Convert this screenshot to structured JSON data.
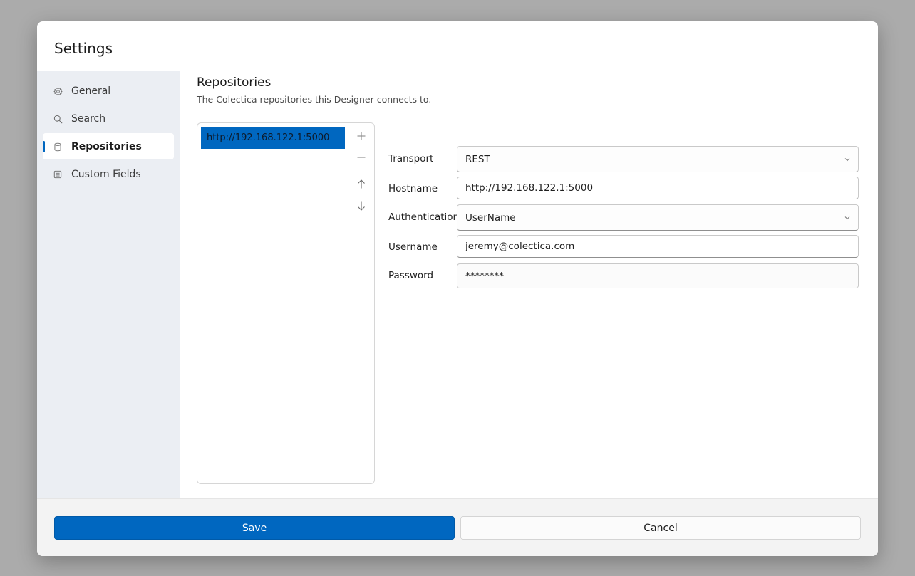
{
  "dialog": {
    "title": "Settings"
  },
  "sidebar": {
    "items": [
      {
        "label": "General",
        "icon": "gear-icon",
        "selected": false
      },
      {
        "label": "Search",
        "icon": "search-icon",
        "selected": false
      },
      {
        "label": "Repositories",
        "icon": "database-icon",
        "selected": true
      },
      {
        "label": "Custom Fields",
        "icon": "list-icon",
        "selected": false
      }
    ]
  },
  "content": {
    "title": "Repositories",
    "description": "The Colectica repositories this Designer connects to.",
    "repositories": [
      "http://192.168.122.1:5000"
    ],
    "list_buttons": {
      "add": "add-icon",
      "remove": "remove-icon",
      "move_up": "arrow-up-icon",
      "move_down": "arrow-down-icon"
    },
    "form": {
      "transport": {
        "label": "Transport",
        "value": "REST"
      },
      "hostname": {
        "label": "Hostname",
        "value": "http://192.168.122.1:5000"
      },
      "authentication": {
        "label": "Authentication",
        "value": "UserName"
      },
      "username": {
        "label": "Username",
        "value": "jeremy@colectica.com"
      },
      "password": {
        "label": "Password",
        "value": "********"
      }
    }
  },
  "footer": {
    "save_label": "Save",
    "cancel_label": "Cancel"
  },
  "colors": {
    "accent": "#0067c0",
    "sidebar_bg": "#ebeef3",
    "backdrop": "#ababab"
  }
}
